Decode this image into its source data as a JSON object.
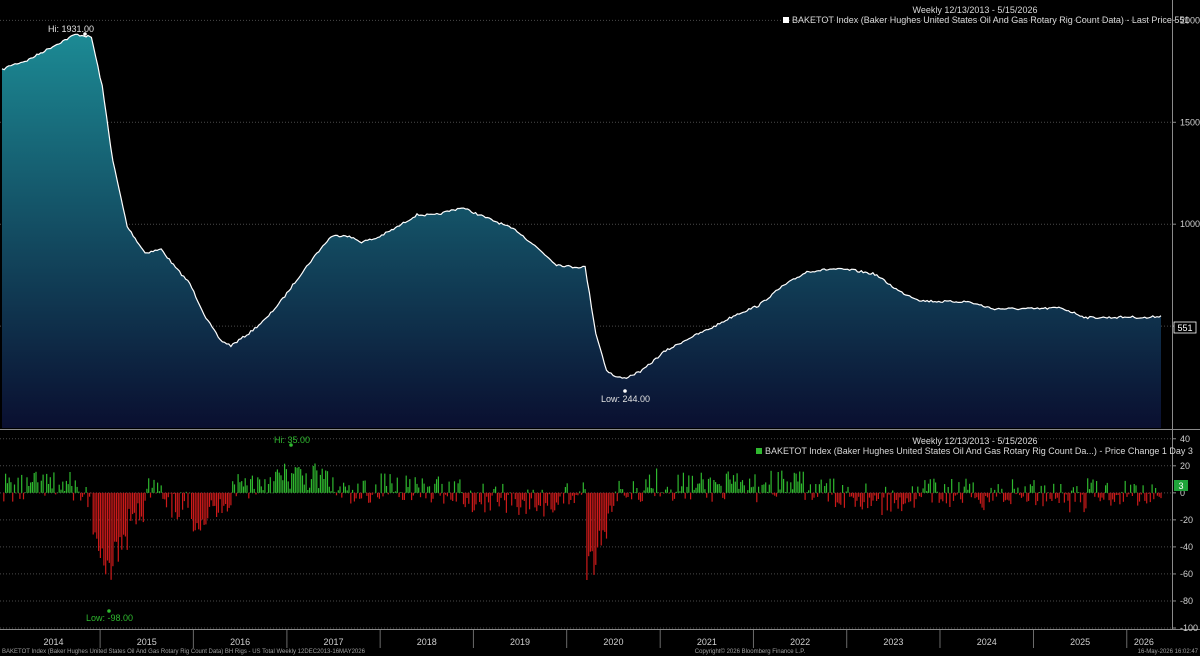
{
  "upper": {
    "title": "Weekly 12/13/2013 - 5/15/2026",
    "legend": "BAKETOT Index (Baker Hughes United States Oil And Gas Rotary Rig Count Data) - Last Price 551",
    "hi_label": "Hi: 1931.00",
    "low_label": "Low: 244.00",
    "last_value": "551",
    "y_ticks": [
      "2000",
      "1500",
      "1000",
      "500"
    ]
  },
  "lower": {
    "title": "Weekly 12/13/2013 - 5/15/2026",
    "legend": "BAKETOT Index (Baker Hughes United States Oil And Gas Rotary Rig Count Da...) - Price Change 1 Day 3",
    "hi_label": "Hi: 35.00",
    "low_label": "Low: -98.00",
    "last_value": "3",
    "y_ticks": [
      "40",
      "20",
      "0",
      "-20",
      "-40",
      "-60",
      "-80",
      "-100"
    ]
  },
  "x_axis": {
    "years": [
      "2014",
      "2015",
      "2016",
      "2017",
      "2018",
      "2019",
      "2020",
      "2021",
      "2022",
      "2023",
      "2024",
      "2025",
      "2026"
    ]
  },
  "footer": {
    "left": "BAKETOT Index (Baker Hughes United States Oil And Gas Rotary Rig Count Data) BH Rigs - US Total Weekly 12DEC2013-16MAY2026",
    "center": "Copyright© 2026 Bloomberg Finance L.P.",
    "right": "16-May-2026 16:02:47"
  },
  "colors": {
    "line": "#ffffff",
    "area_top": "#1c8a94",
    "area_bottom": "#0a0f30",
    "up": "#2fb82f",
    "down": "#cc1a1a",
    "last_badge": "#1fa33a"
  },
  "chart_data": [
    {
      "type": "area",
      "title": "Weekly 12/13/2013 - 5/15/2026",
      "series": [
        {
          "name": "BAKETOT Index (Baker Hughes United States Oil And Gas Rotary Rig Count Data)"
        }
      ],
      "x": [
        "2013-12-13",
        "2014-01-17",
        "2014-03-21",
        "2014-06-13",
        "2014-09-26",
        "2014-10-31",
        "2014-11-28",
        "2015-01-09",
        "2015-02-20",
        "2015-04-17",
        "2015-06-26",
        "2015-08-28",
        "2015-10-23",
        "2015-12-18",
        "2016-02-19",
        "2016-04-15",
        "2016-05-27",
        "2016-08-05",
        "2016-10-14",
        "2016-12-16",
        "2017-02-24",
        "2017-04-28",
        "2017-06-23",
        "2017-08-18",
        "2017-10-20",
        "2017-12-15",
        "2018-03-02",
        "2018-05-25",
        "2018-08-03",
        "2018-11-16",
        "2019-01-25",
        "2019-04-12",
        "2019-06-21",
        "2019-09-06",
        "2019-11-22",
        "2020-01-24",
        "2020-03-13",
        "2020-04-24",
        "2020-06-05",
        "2020-07-10",
        "2020-08-14",
        "2020-10-23",
        "2021-01-15",
        "2021-04-23",
        "2021-07-30",
        "2021-10-22",
        "2022-01-21",
        "2022-04-22",
        "2022-07-29",
        "2022-11-04",
        "2023-01-20",
        "2023-04-21",
        "2023-07-28",
        "2023-10-20",
        "2024-01-19",
        "2024-04-19",
        "2024-07-26",
        "2024-10-25",
        "2025-01-17",
        "2025-04-18",
        "2025-07-25",
        "2025-10-24",
        "2026-01-16",
        "2026-03-20",
        "2026-05-15"
      ],
      "values": [
        1757,
        1780,
        1803,
        1861,
        1931,
        1925,
        1917,
        1676,
        1310,
        988,
        859,
        877,
        787,
        709,
        541,
        431,
        404,
        464,
        539,
        634,
        754,
        857,
        940,
        947,
        913,
        930,
        981,
        1046,
        1044,
        1082,
        1045,
        1006,
        967,
        886,
        802,
        790,
        790,
        465,
        284,
        251,
        244,
        282,
        373,
        440,
        497,
        555,
        601,
        693,
        767,
        780,
        775,
        755,
        669,
        624,
        620,
        620,
        585,
        585,
        585,
        590,
        542,
        542,
        545,
        540,
        551
      ],
      "ylim": [
        0,
        2100
      ]
    },
    {
      "type": "bar",
      "title": "Weekly 12/13/2013 - 5/15/2026",
      "series": [
        {
          "name": "BAKETOT Index (Baker Hughes United States Oil And Gas Rotary Rig Count Da...)"
        }
      ],
      "annotations": {
        "high": 35,
        "low": -98,
        "last": 3
      },
      "ylim": [
        -100,
        45
      ]
    }
  ]
}
